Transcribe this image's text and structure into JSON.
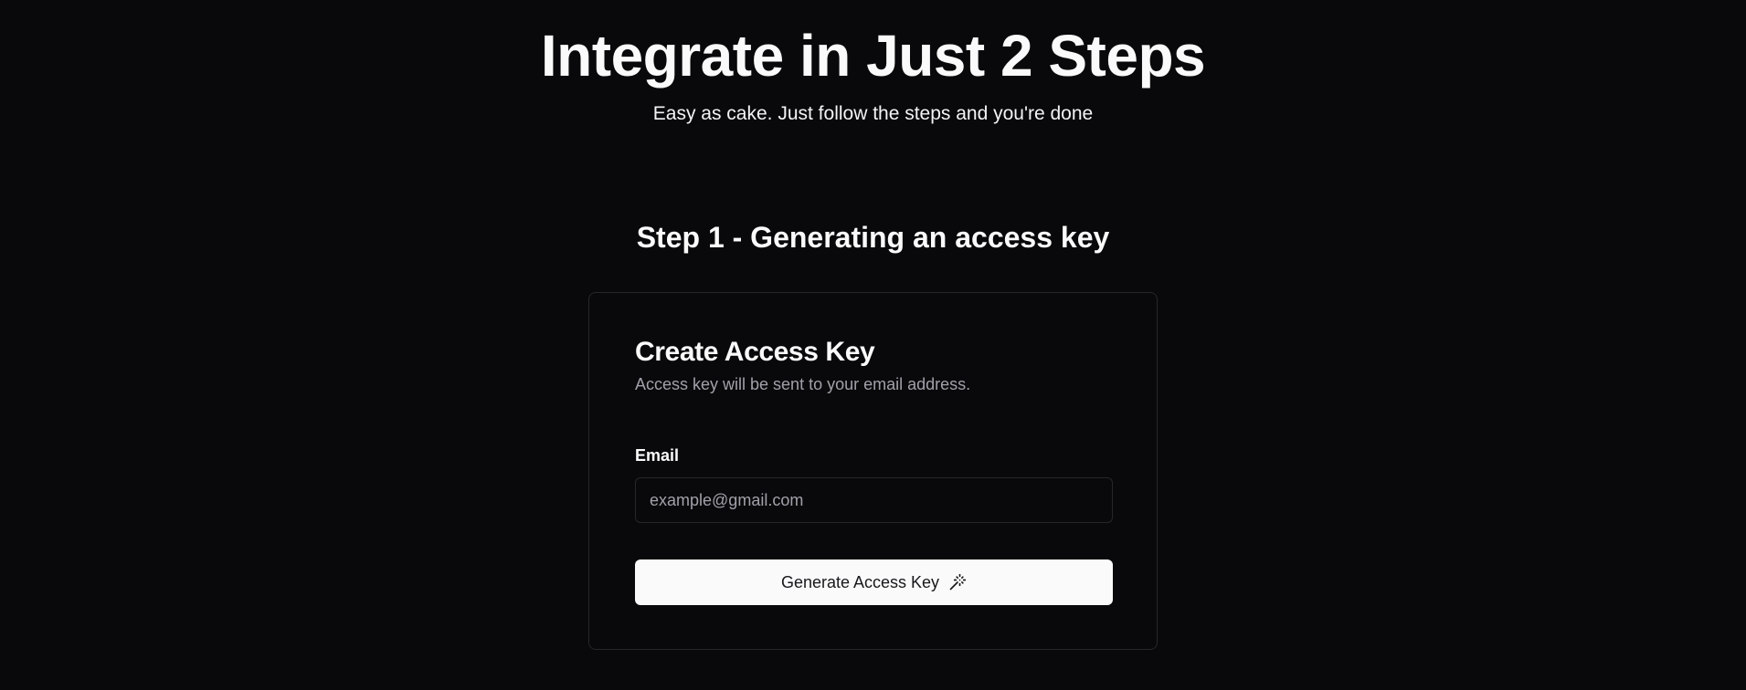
{
  "hero": {
    "title": "Integrate in Just 2 Steps",
    "subtitle": "Easy as cake. Just follow the steps and you're done"
  },
  "step": {
    "title": "Step 1 - Generating an access key"
  },
  "card": {
    "title": "Create Access Key",
    "description": "Access key will be sent to your email address.",
    "email_label": "Email",
    "email_value": "",
    "email_placeholder": "example@gmail.com",
    "button_label": "Generate Access Key",
    "button_icon": "magic-wand-icon"
  },
  "colors": {
    "background": "#09090b",
    "text": "#fafafa",
    "muted_text": "#a1a1aa",
    "border": "#27272a",
    "button_bg": "#fafafa",
    "button_text": "#18181b"
  }
}
